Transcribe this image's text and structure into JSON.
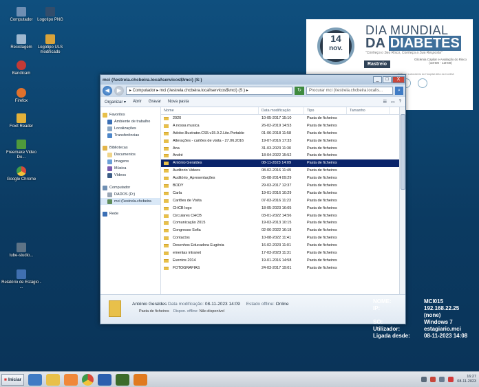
{
  "desktop": {
    "icons": [
      {
        "label": "Computador"
      },
      {
        "label": "Logotipo PNG"
      },
      {
        "label": "Reciclagem"
      },
      {
        "label": "Logotipo ULS modificado"
      },
      {
        "label": "Bandicam"
      },
      {
        "label": "Firefox"
      },
      {
        "label": "Foxit Reader"
      },
      {
        "label": "Freemake Video Do..."
      },
      {
        "label": "Google Chrome"
      },
      {
        "label": "tube-studio..."
      },
      {
        "label": "Relatório de Estágio - ..."
      }
    ]
  },
  "banner": {
    "day": "14",
    "month": "nov.",
    "title_line1": "DIA MUNDIAL",
    "title_da": "DA",
    "title_highlight": "DIABETES",
    "tagline": "\"Conheça o Seu Risco, Conheça a Sua Resposta\"",
    "rastreio": "Rastreio",
    "glicemia": "Glicémia Capilar e Avaliação do Risco (10H00 - 12H00)",
    "local": "Junto ao Laboratório do Hospital Alfra da Covilhã"
  },
  "window": {
    "title": "mci (\\\\estrela.chcbeira.local\\servicos$\\mci) (S:)",
    "address": "▸ Computador ▸ mci (\\\\estrela.chcbeira.local\\servicos$\\mci) (S:) ▸",
    "search_placeholder": "Procurar mci (\\\\estrela.chcbeira.local\\s...",
    "commands": {
      "organize": "Organizar ▾",
      "open": "Abrir",
      "burn": "Gravar",
      "new_folder": "Nova pasta"
    },
    "controls": {
      "minimize": "_",
      "maximize": "□",
      "close": "X"
    },
    "nav_pane": {
      "favorites_header": "Favoritos",
      "favorites": [
        "Ambiente de trabalho",
        "Localizações",
        "Transferências"
      ],
      "libraries_header": "Bibliotecas",
      "libraries": [
        "Documentos",
        "Imagens",
        "Música",
        "Vídeos"
      ],
      "computer_header": "Computador",
      "computer": [
        "DADOS (D:)",
        "mci (\\\\estrela.chcbeira"
      ],
      "network_header": "Rede"
    },
    "columns": {
      "name": "Nome",
      "date": "Data modificação",
      "type": "Tipo",
      "size": "Tamanho"
    },
    "files": [
      {
        "name": "2020",
        "date": "10-05-2017 15:10",
        "type": "Pasta de ficheiros"
      },
      {
        "name": "A nossa musica",
        "date": "26-02-2019 14:53",
        "type": "Pasta de ficheiros"
      },
      {
        "name": "Adobe.Illustrator.CS5.v15.0.2.Lite.Portable",
        "date": "01-06-2018 11:58",
        "type": "Pasta de ficheiros"
      },
      {
        "name": "Alterações - cartões de visita - 27.06.2016",
        "date": "19-07-2016 17:33",
        "type": "Pasta de ficheiros"
      },
      {
        "name": "Ana",
        "date": "31-03-2023 11:30",
        "type": "Pasta de ficheiros"
      },
      {
        "name": "André",
        "date": "18-04-2022 15:52",
        "type": "Pasta de ficheiros"
      },
      {
        "name": "António Geraldes",
        "date": "08-11-2023 14:09",
        "type": "Pasta de ficheiros",
        "selected": true
      },
      {
        "name": "Auditorio Videos",
        "date": "08-02-2016 11:49",
        "type": "Pasta de ficheiros"
      },
      {
        "name": "Auditório_Apresentações",
        "date": "05-08-2014 09:29",
        "type": "Pasta de ficheiros"
      },
      {
        "name": "BODY",
        "date": "29-03-2017 12:37",
        "type": "Pasta de ficheiros"
      },
      {
        "name": "Carla",
        "date": "19-01-2016 10:29",
        "type": "Pasta de ficheiros"
      },
      {
        "name": "Cartões de Visita",
        "date": "07-03-2016 11:23",
        "type": "Pasta de ficheiros"
      },
      {
        "name": "CHCB logo",
        "date": "18-05-2023 16:05",
        "type": "Pasta de ficheiros"
      },
      {
        "name": "Circulares CHCB",
        "date": "03-01-2022 14:56",
        "type": "Pasta de ficheiros"
      },
      {
        "name": "Comunicação 2015",
        "date": "19-03-2013 10:15",
        "type": "Pasta de ficheiros"
      },
      {
        "name": "Congresso Sofia",
        "date": "02-06-2022 16:18",
        "type": "Pasta de ficheiros"
      },
      {
        "name": "Contactos",
        "date": "10-08-2022 11:41",
        "type": "Pasta de ficheiros"
      },
      {
        "name": "Desenhos Educadora Eugénia",
        "date": "16-02-2023 11:01",
        "type": "Pasta de ficheiros"
      },
      {
        "name": "ementas intranet",
        "date": "17-03-2023 11:31",
        "type": "Pasta de ficheiros"
      },
      {
        "name": "Eventos 2014",
        "date": "19-01-2016 14:58",
        "type": "Pasta de ficheiros"
      },
      {
        "name": "FOTOGRAFIAS",
        "date": "24-03-2017 19:01",
        "type": "Pasta de ficheiros"
      }
    ],
    "details": {
      "name": "António Geraldes",
      "date_label": "Data modificação:",
      "date_value": "08-11-2023 14:09",
      "offline_status_label": "Estado offline:",
      "offline_status_value": "Online",
      "type": "Pasta de ficheiros",
      "availability_label": "Dispon. offline:",
      "availability_value": "Não disponível"
    }
  },
  "sysinfo": {
    "nome_label": "NOME:",
    "nome": "MCI015",
    "ip_label": "IP:",
    "ip": "192.168.22.25",
    "ip_extra": "(none)",
    "so_label": "SO:",
    "so": "Windows 7",
    "user_label": "Utilizador:",
    "user": "estagiario.mci",
    "logon_label": "Ligada desde:",
    "logon": "08-11-2023 14:08"
  },
  "taskbar": {
    "start": "Iniciar",
    "time": "16:27",
    "date": "08-11-2023"
  }
}
